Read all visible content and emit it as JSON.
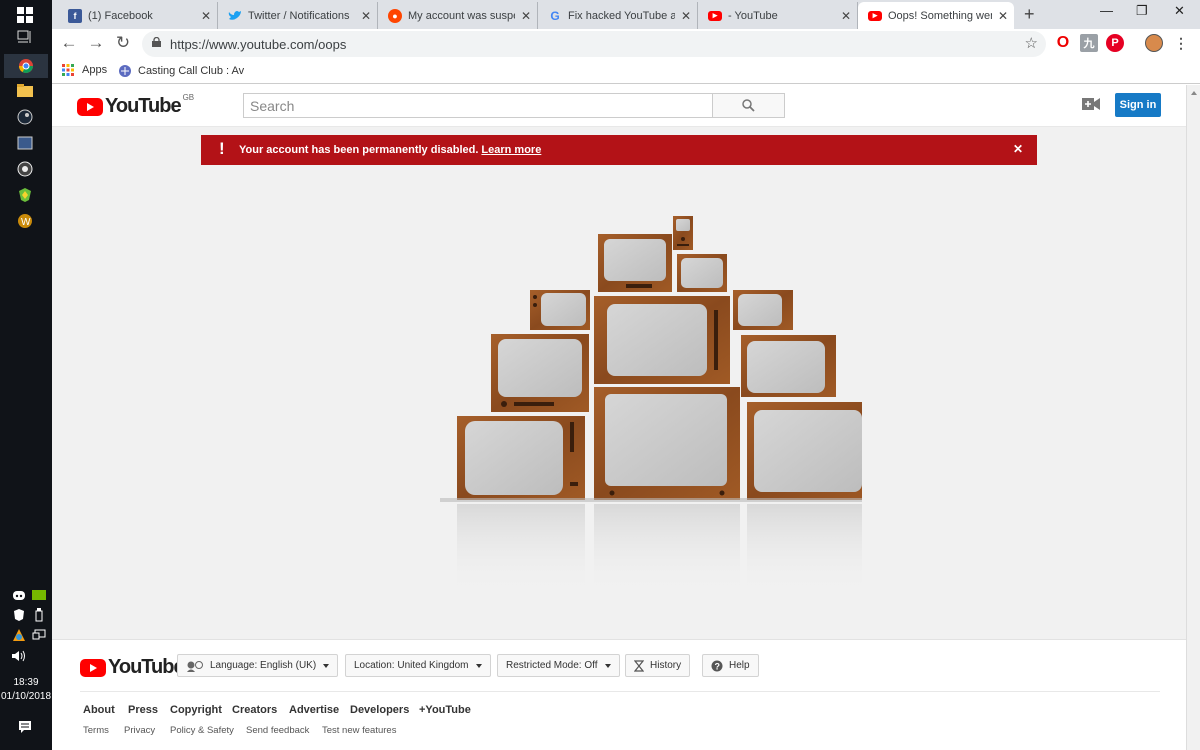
{
  "taskbar": {
    "clock_time": "18:39",
    "clock_date": "01/10/2018"
  },
  "browser": {
    "tabs": [
      {
        "title": "(1) Facebook",
        "icon": "facebook-icon"
      },
      {
        "title": "Twitter / Notifications",
        "icon": "twitter-icon"
      },
      {
        "title": "My account was suspen",
        "icon": "reddit-icon"
      },
      {
        "title": "Fix hacked YouTube acc",
        "icon": "google-icon"
      },
      {
        "title": "- YouTube",
        "icon": "youtube-icon"
      },
      {
        "title": "Oops! Something went",
        "icon": "youtube-icon",
        "active": true
      }
    ],
    "url": "https://www.youtube.com/oops",
    "bookmarks": {
      "apps_label": "Apps",
      "casting_call_label": "Casting Call Club : Av"
    }
  },
  "youtube": {
    "logo_text": "YouTube",
    "country_code": "GB",
    "search_placeholder": "Search",
    "signin_label": "Sign in",
    "alert": {
      "message": "Your account has been permanently disabled.",
      "link_text": "Learn more",
      "color": "#b31217"
    },
    "footer": {
      "logo_text": "YouTube",
      "language_label": "Language: English (UK)",
      "location_label": "Location: United Kingdom",
      "restricted_label": "Restricted Mode: Off",
      "history_label": "History",
      "help_label": "Help",
      "links_primary": [
        "About",
        "Press",
        "Copyright",
        "Creators",
        "Advertise",
        "Developers",
        "+YouTube"
      ],
      "links_secondary": [
        "Terms",
        "Privacy",
        "Policy & Safety",
        "Send feedback",
        "Test new features"
      ]
    }
  },
  "colors": {
    "youtube_red": "#ff0000",
    "signin_blue": "#167ac6",
    "page_background": "#f1f1f1"
  }
}
